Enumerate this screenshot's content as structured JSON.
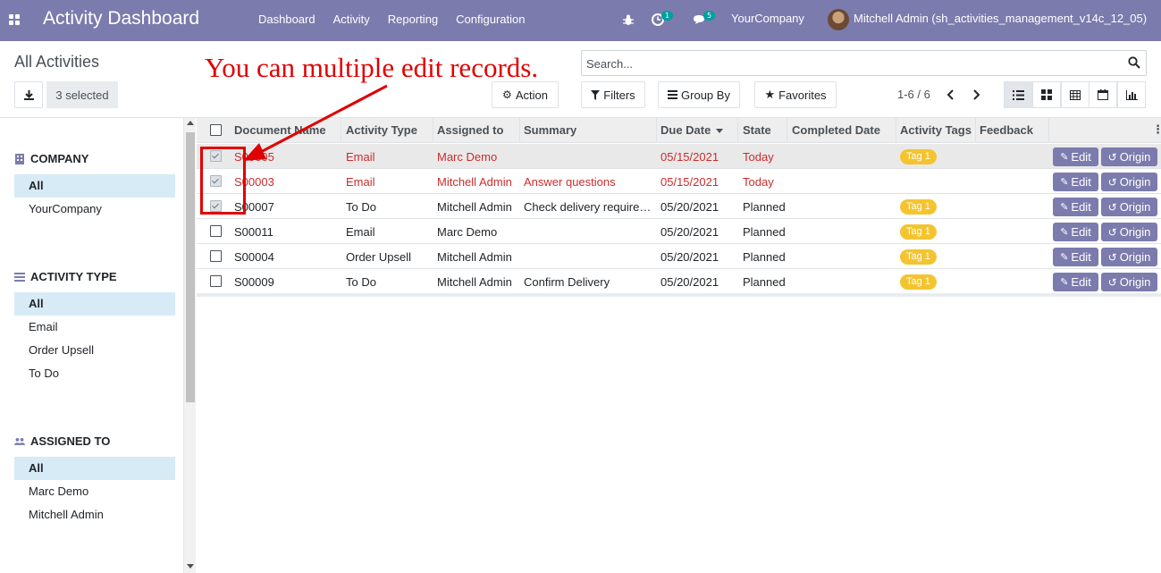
{
  "navbar": {
    "title": "Activity Dashboard",
    "menu": [
      "Dashboard",
      "Activity",
      "Reporting",
      "Configuration"
    ],
    "activity_badge": "1",
    "messages_badge": "5",
    "company": "YourCompany",
    "user": "Mitchell Admin (sh_activities_management_v14c_12_05)"
  },
  "control": {
    "title": "All Activities",
    "selected": "3 selected",
    "action_label": "Action",
    "search_placeholder": "Search...",
    "filters_label": "Filters",
    "groupby_label": "Group By",
    "favorites_label": "Favorites",
    "pager": "1-6 / 6"
  },
  "sidebar": {
    "company_title": "COMPANY",
    "company_items": [
      "All",
      "YourCompany"
    ],
    "activity_title": "ACTIVITY TYPE",
    "activity_items": [
      "All",
      "Email",
      "Order Upsell",
      "To Do"
    ],
    "assigned_title": "ASSIGNED TO",
    "assigned_items": [
      "All",
      "Marc Demo",
      "Mitchell Admin"
    ]
  },
  "table": {
    "columns": [
      "Document Name",
      "Activity Type",
      "Assigned to",
      "Summary",
      "Due Date",
      "State",
      "Completed Date",
      "Activity Tags",
      "Feedback"
    ],
    "edit_label": "Edit",
    "origin_label": "Origin",
    "rows": [
      {
        "doc": "S00005",
        "type": "Email",
        "assigned": "Marc Demo",
        "summary": "",
        "due": "05/15/2021",
        "state": "Today",
        "tag": "Tag 1",
        "checked": true,
        "red": true
      },
      {
        "doc": "S00003",
        "type": "Email",
        "assigned": "Mitchell Admin",
        "summary": "Answer questions",
        "due": "05/15/2021",
        "state": "Today",
        "tag": "",
        "checked": true,
        "red": true
      },
      {
        "doc": "S00007",
        "type": "To Do",
        "assigned": "Mitchell Admin",
        "summary": "Check delivery requirements",
        "due": "05/20/2021",
        "state": "Planned",
        "tag": "Tag 1",
        "checked": true,
        "red": false
      },
      {
        "doc": "S00011",
        "type": "Email",
        "assigned": "Marc Demo",
        "summary": "",
        "due": "05/20/2021",
        "state": "Planned",
        "tag": "Tag 1",
        "checked": false,
        "red": false
      },
      {
        "doc": "S00004",
        "type": "Order Upsell",
        "assigned": "Mitchell Admin",
        "summary": "",
        "due": "05/20/2021",
        "state": "Planned",
        "tag": "Tag 1",
        "checked": false,
        "red": false
      },
      {
        "doc": "S00009",
        "type": "To Do",
        "assigned": "Mitchell Admin",
        "summary": "Confirm Delivery",
        "due": "05/20/2021",
        "state": "Planned",
        "tag": "Tag 1",
        "checked": false,
        "red": false
      }
    ]
  },
  "annotation": {
    "text": "You can multiple edit records."
  },
  "colors": {
    "brand": "#7c7bad",
    "overdue": "#cc2c2c",
    "tag": "#f4c430",
    "annotation": "#e00000"
  }
}
